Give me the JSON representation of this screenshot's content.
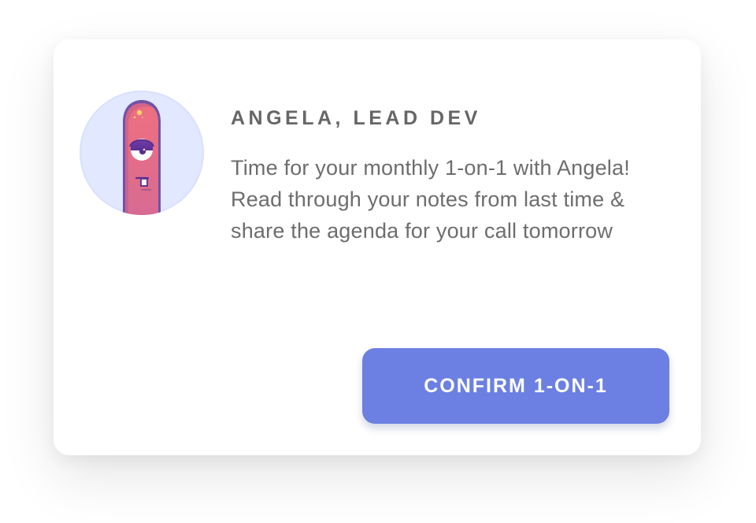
{
  "card": {
    "title": "ANGELA, LEAD DEV",
    "message": "Time for your monthly 1-on-1 with Angela! Read through your notes from last time & share the agenda for your call tomorrow",
    "action_label": "CONFIRM 1-ON-1",
    "avatar": {
      "icon": "cyclops-character-icon",
      "background_color": "#e2e8ff",
      "character_color": "#e36f82"
    }
  },
  "colors": {
    "title_text": "#666666",
    "body_text": "#6d6d6d",
    "button": "#6b80e2",
    "button_text": "#ffffff"
  }
}
